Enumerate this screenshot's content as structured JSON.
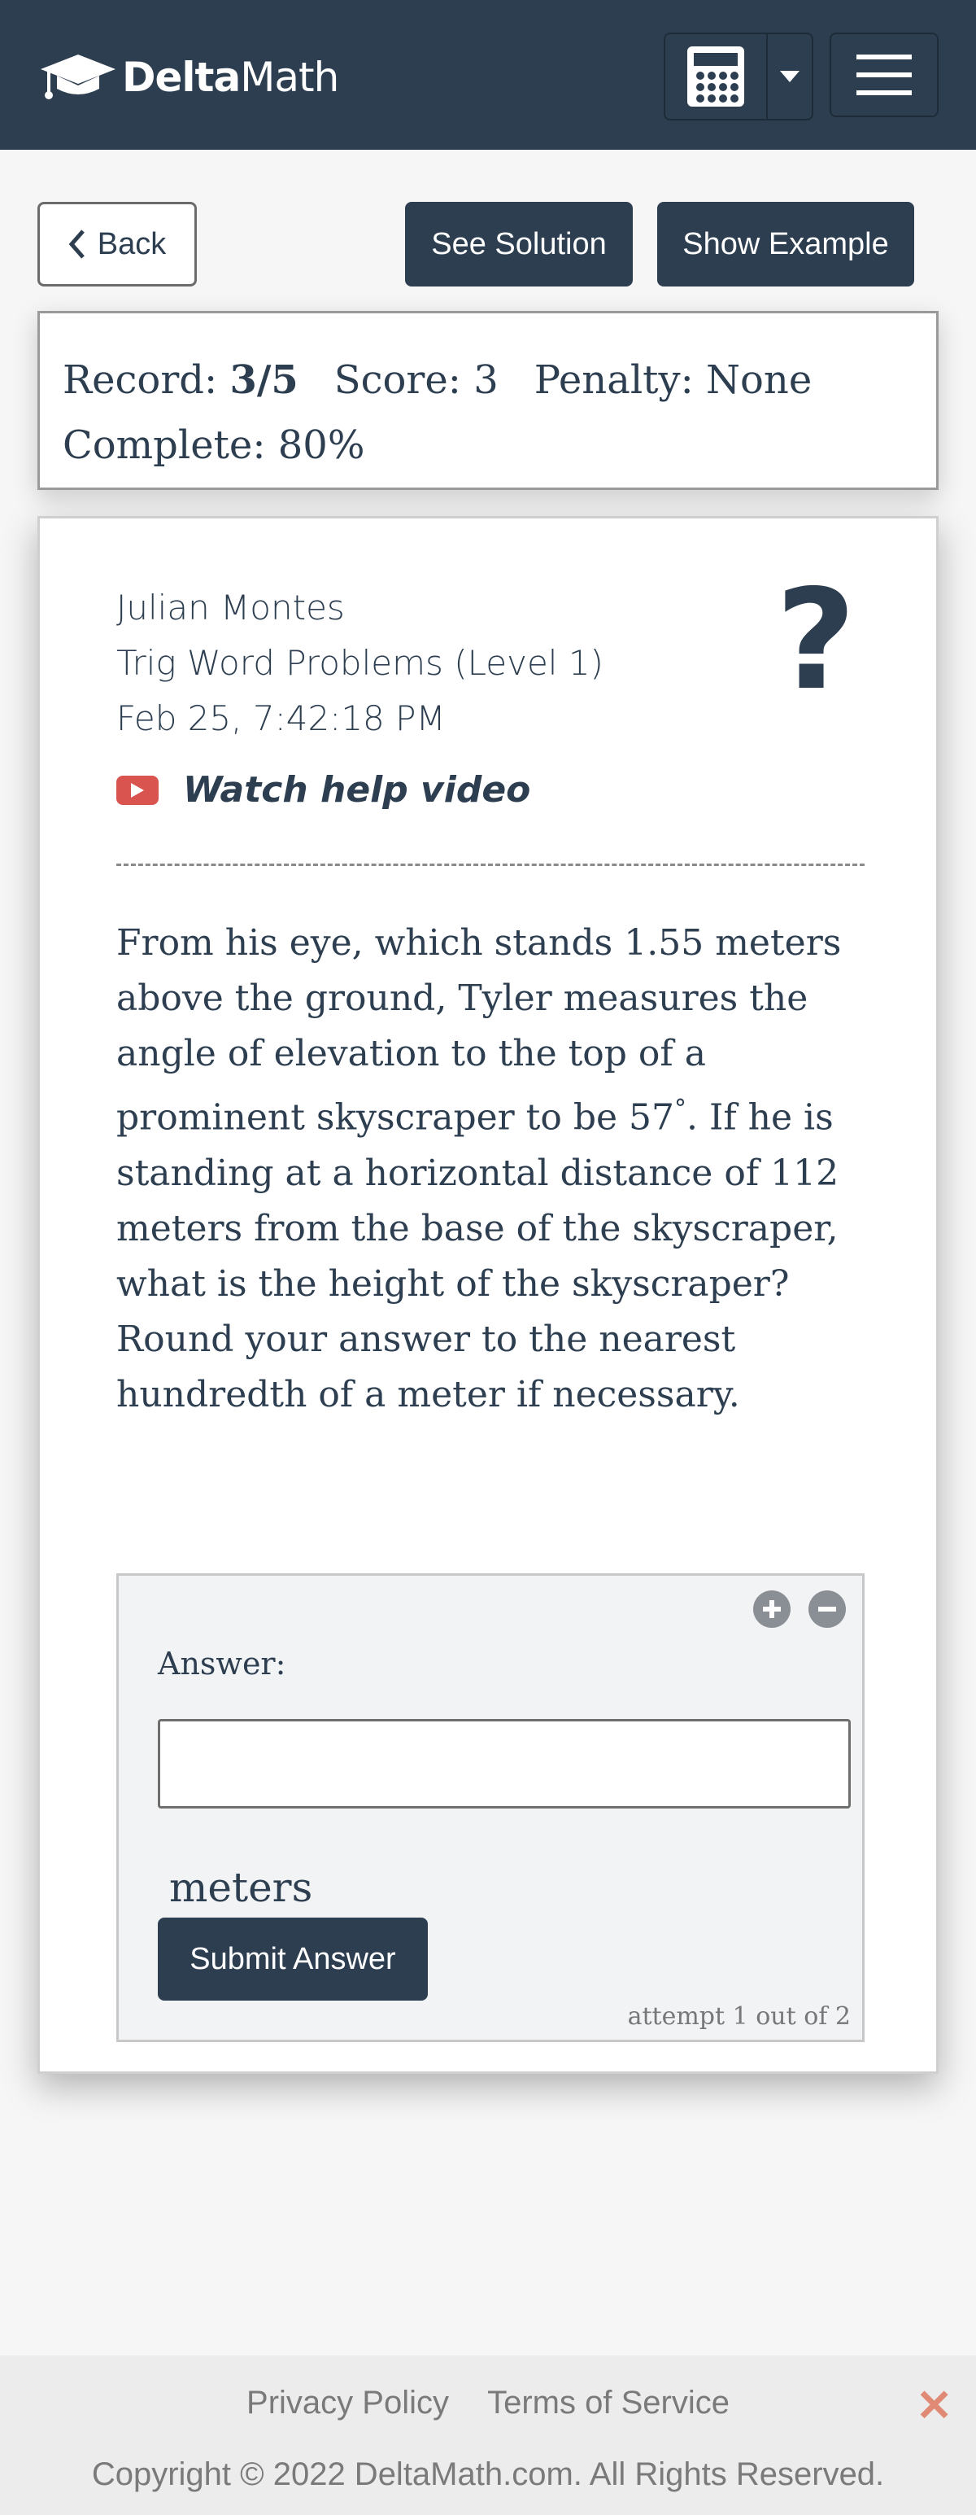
{
  "header": {
    "brand_delta": "Delta",
    "brand_math": "Math"
  },
  "actions": {
    "back_label": "Back",
    "see_solution_label": "See Solution",
    "show_example_label": "Show Example"
  },
  "record": {
    "record_label": "Record:",
    "record_value": "3/5",
    "score_text": "Score: 3",
    "penalty_text": "Penalty: None",
    "complete_text": "Complete: 80%"
  },
  "assignment": {
    "student_name": "Julian Montes",
    "skill": "Trig Word Problems (Level 1)",
    "timestamp": "Feb 25, 7:42:18 PM",
    "help_symbol": "?",
    "video_link": "Watch help video"
  },
  "problem": {
    "text_part1": "From his eye, which stands 1.55 meters above the ground, Tyler measures the angle of elevation to the top of a prominent skyscraper to be 57",
    "degree": "°",
    "text_part2": ". If he is standing at a horizontal distance of 112 meters from the base of the skyscraper, what is the height of the skyscraper? Round your answer to the nearest hundredth of a meter if necessary."
  },
  "answer": {
    "label": "Answer:",
    "value": "",
    "unit": "meters",
    "submit_label": "Submit Answer",
    "attempt_text": "attempt 1 out of 2"
  },
  "footer": {
    "privacy": "Privacy Policy",
    "terms": "Terms of Service",
    "copyright": "Copyright © 2022 DeltaMath.com. All Rights Reserved.",
    "close_symbol": "✕"
  },
  "colors": {
    "navy": "#2c3e50",
    "youtube_red": "#d9534f",
    "close_orange": "#e08a75"
  },
  "icons": [
    "graduation-cap-icon",
    "calculator-icon",
    "caret-down-icon",
    "hamburger-menu-icon",
    "chevron-left-icon",
    "youtube-icon",
    "plus-circle-icon",
    "minus-circle-icon",
    "close-icon"
  ]
}
